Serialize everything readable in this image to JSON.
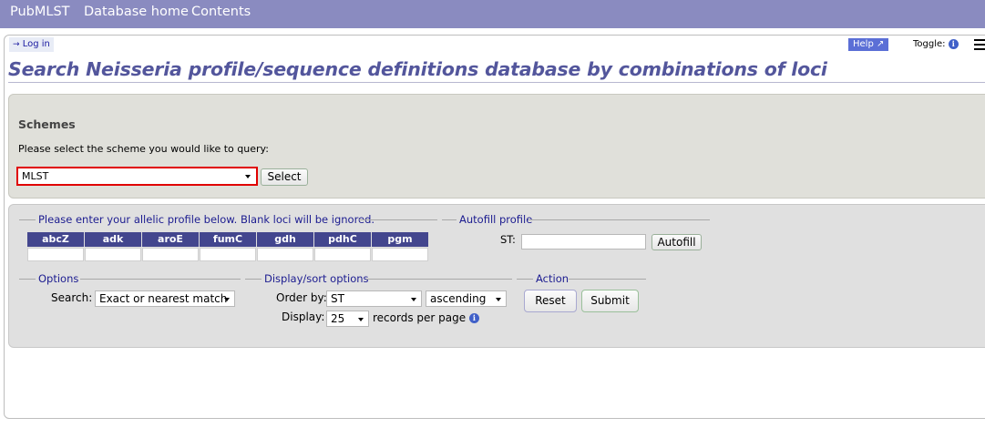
{
  "topnav": {
    "brand": "PubMLST",
    "database_home": "Database home",
    "contents": "Contents"
  },
  "toolbar": {
    "login": "Log in",
    "help": "Help",
    "toggle": "Toggle:"
  },
  "page": {
    "title": "Search Neisseria profile/sequence definitions database by combinations of loci"
  },
  "schemes": {
    "heading": "Schemes",
    "prompt": "Please select the scheme you would like to query:",
    "selected": "MLST",
    "select_button": "Select"
  },
  "profile": {
    "legend": "Please enter your allelic profile below. Blank loci will be ignored.",
    "loci": [
      "abcZ",
      "adk",
      "aroE",
      "fumC",
      "gdh",
      "pdhC",
      "pgm"
    ]
  },
  "autofill": {
    "legend": "Autofill profile",
    "st_label": "ST:",
    "button": "Autofill"
  },
  "options": {
    "legend": "Options",
    "search_label": "Search:",
    "search_value": "Exact or nearest match"
  },
  "display": {
    "legend": "Display/sort options",
    "order_label": "Order by:",
    "order_value": "ST",
    "direction_value": "ascending",
    "display_label": "Display:",
    "display_value": "25",
    "records_label": "records per page"
  },
  "action": {
    "legend": "Action",
    "reset": "Reset",
    "submit": "Submit"
  },
  "colors": {
    "topbar": "#8a8bc0",
    "title": "#53569c",
    "locus_header": "#43468e",
    "highlight": "#e00000"
  }
}
